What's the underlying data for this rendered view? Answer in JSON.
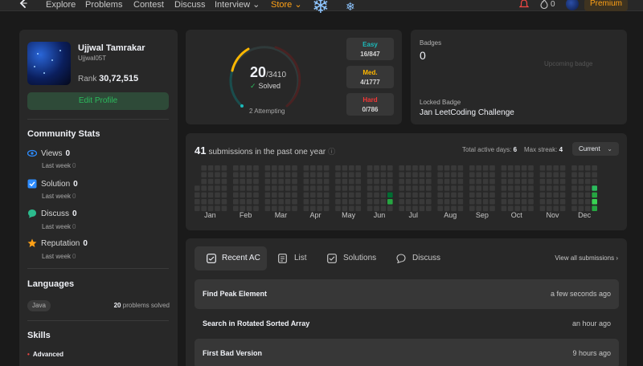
{
  "nav": {
    "items": [
      "Explore",
      "Problems",
      "Contest",
      "Discuss",
      "Interview ⌄",
      "Store ⌄"
    ],
    "streak_count": "0",
    "premium_label": "Premium"
  },
  "profile": {
    "name": "Ujjwal Tamrakar",
    "username": "Ujjwal05T",
    "rank_label": "Rank",
    "rank_value": "30,72,515",
    "edit_label": "Edit Profile"
  },
  "community": {
    "title": "Community Stats",
    "stats": [
      {
        "label": "Views",
        "value": "0",
        "sub_label": "Last week",
        "sub_value": "0",
        "color": "#2d8cff"
      },
      {
        "label": "Solution",
        "value": "0",
        "sub_label": "Last week",
        "sub_value": "0",
        "color": "#2d8cff"
      },
      {
        "label": "Discuss",
        "value": "0",
        "sub_label": "Last week",
        "sub_value": "0",
        "color": "#2cbb8d"
      },
      {
        "label": "Reputation",
        "value": "0",
        "sub_label": "Last week",
        "sub_value": "0",
        "color": "#ffa116"
      }
    ]
  },
  "languages": {
    "title": "Languages",
    "items": [
      {
        "name": "Java",
        "count": "20",
        "suffix": "problems solved"
      }
    ]
  },
  "skills": {
    "title": "Skills",
    "items": [
      "Advanced"
    ]
  },
  "solved": {
    "solved": "20",
    "total": "/3410",
    "solved_label": "Solved",
    "attempting": "2 Attempting",
    "difficulties": [
      {
        "name": "Easy",
        "value": "16/847",
        "color": "#1cbaba"
      },
      {
        "name": "Med.",
        "value": "4/1777",
        "color": "#ffb700"
      },
      {
        "name": "Hard",
        "value": "0/786",
        "color": "#f63737"
      }
    ]
  },
  "badges": {
    "title": "Badges",
    "count": "0",
    "upcoming": "Upcoming badge",
    "locked_title": "Locked Badge",
    "locked_name": "Jan LeetCoding Challenge"
  },
  "heatmap": {
    "count": "41",
    "label": "submissions in the past one year",
    "active_label": "Total active days:",
    "active_value": "6",
    "streak_label": "Max streak:",
    "streak_value": "4",
    "range": "Current",
    "months": [
      "Jan",
      "Feb",
      "Mar",
      "Apr",
      "May",
      "Jun",
      "Jul",
      "Aug",
      "Sep",
      "Oct",
      "Nov",
      "Dec"
    ]
  },
  "recent": {
    "tabs": [
      "Recent AC",
      "List",
      "Solutions",
      "Discuss"
    ],
    "view_all": "View all submissions",
    "rows": [
      {
        "title": "Find Peak Element",
        "time": "a few seconds ago"
      },
      {
        "title": "Search in Rotated Sorted Array",
        "time": "an hour ago"
      },
      {
        "title": "First Bad Version",
        "time": "9 hours ago"
      }
    ]
  }
}
